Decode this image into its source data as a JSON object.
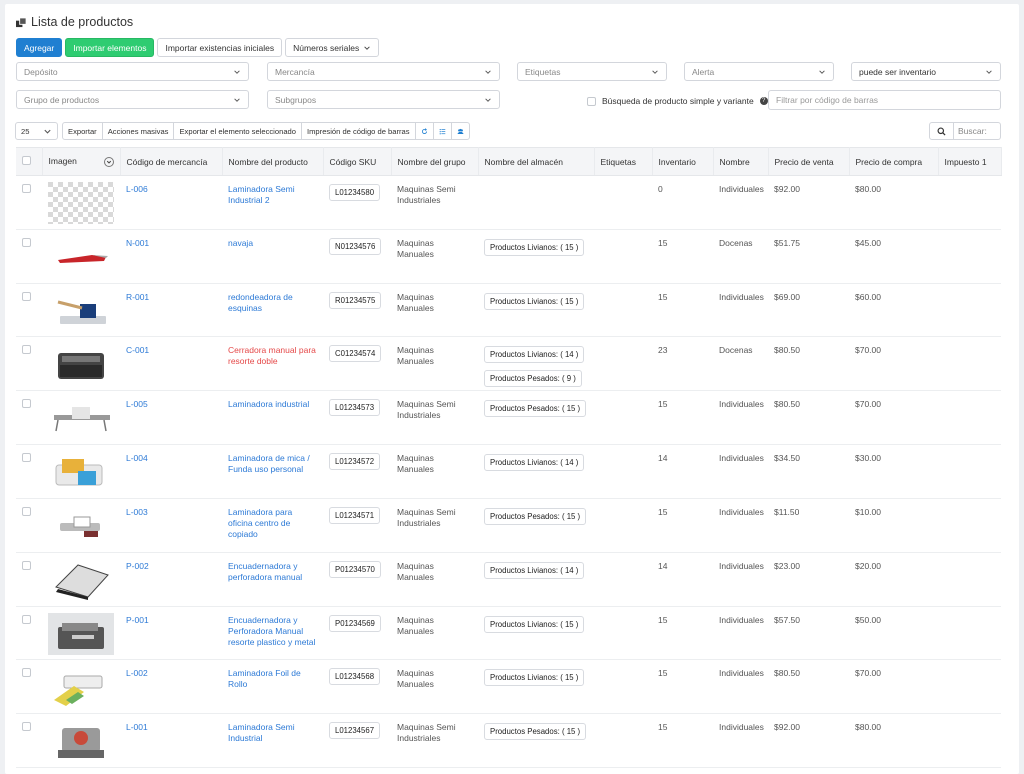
{
  "page": {
    "title": "Lista de productos"
  },
  "toolbar": {
    "add": "Agregar",
    "import_items": "Importar elementos",
    "import_stock": "Importar existencias iniciales",
    "serials": "Números seriales"
  },
  "filters": {
    "deposito": "Depósito",
    "mercancia": "Mercancía",
    "etiquetas": "Etiquetas",
    "alerta": "Alerta",
    "inventario": "puede ser inventario",
    "grupo": "Grupo de productos",
    "subgrupos": "Subgrupos",
    "simple_search": "Búsqueda de producto simple y variante",
    "barcode_placeholder": "Filtrar por código de barras"
  },
  "actions": {
    "page_size": "25",
    "export": "Exportar",
    "bulk": "Acciones masivas",
    "export_selected": "Exportar el elemento seleccionado",
    "print_barcode": "Impresión de código de barras",
    "search_placeholder": "Buscar:"
  },
  "table": {
    "headers": [
      "Imagen",
      "Código de mercancía",
      "Nombre del producto",
      "Código SKU",
      "Nombre del grupo",
      "Nombre del almacén",
      "Etiquetas",
      "Inventario",
      "Nombre",
      "Precio de venta",
      "Precio de compra",
      "Impuesto 1"
    ],
    "rows": [
      {
        "code": "L-006",
        "name": "Laminadora Semi Industrial 2",
        "sku": "L01234580",
        "group": "Maquinas Semi Industriales",
        "warehouses": [],
        "inventory": "0",
        "unit": "Individuales",
        "sale": "$92.00",
        "cost": "$80.00"
      },
      {
        "code": "N-001",
        "name": "navaja",
        "sku": "N01234576",
        "group": "Maquinas Manuales",
        "warehouses": [
          "Productos Livianos: ( 15 )"
        ],
        "inventory": "15",
        "unit": "Docenas",
        "sale": "$51.75",
        "cost": "$45.00"
      },
      {
        "code": "R-001",
        "name": "redondeadora de esquinas",
        "sku": "R01234575",
        "group": "Maquinas Manuales",
        "warehouses": [
          "Productos Livianos: ( 15 )"
        ],
        "inventory": "15",
        "unit": "Individuales",
        "sale": "$69.00",
        "cost": "$60.00"
      },
      {
        "code": "C-001",
        "name": "Cerradora manual para resorte doble",
        "sku": "C01234574",
        "group": "Maquinas Manuales",
        "warehouses": [
          "Productos Livianos: ( 14 )",
          "Productos Pesados: ( 9 )"
        ],
        "inventory": "23",
        "unit": "Docenas",
        "sale": "$80.50",
        "cost": "$70.00"
      },
      {
        "code": "L-005",
        "name": "Laminadora industrial",
        "sku": "L01234573",
        "group": "Maquinas Semi Industriales",
        "warehouses": [
          "Productos Pesados: ( 15 )"
        ],
        "inventory": "15",
        "unit": "Individuales",
        "sale": "$80.50",
        "cost": "$70.00"
      },
      {
        "code": "L-004",
        "name": "Laminadora de mica / Funda uso personal",
        "sku": "L01234572",
        "group": "Maquinas Manuales",
        "warehouses": [
          "Productos Livianos: ( 14 )"
        ],
        "inventory": "14",
        "unit": "Individuales",
        "sale": "$34.50",
        "cost": "$30.00"
      },
      {
        "code": "L-003",
        "name": "Laminadora para oficina centro de copiado",
        "sku": "L01234571",
        "group": "Maquinas Semi Industriales",
        "warehouses": [
          "Productos Pesados: ( 15 )"
        ],
        "inventory": "15",
        "unit": "Individuales",
        "sale": "$11.50",
        "cost": "$10.00"
      },
      {
        "code": "P-002",
        "name": "Encuadernadora y perforadora manual",
        "sku": "P01234570",
        "group": "Maquinas Manuales",
        "warehouses": [
          "Productos Livianos: ( 14 )"
        ],
        "inventory": "14",
        "unit": "Individuales",
        "sale": "$23.00",
        "cost": "$20.00"
      },
      {
        "code": "P-001",
        "name": "Encuadernadora y Perforadora Manual resorte plastico y metal",
        "sku": "P01234569",
        "group": "Maquinas Manuales",
        "warehouses": [
          "Productos Livianos: ( 15 )"
        ],
        "inventory": "15",
        "unit": "Individuales",
        "sale": "$57.50",
        "cost": "$50.00"
      },
      {
        "code": "L-002",
        "name": "Laminadora Foil de Rollo",
        "sku": "L01234568",
        "group": "Maquinas Manuales",
        "warehouses": [
          "Productos Livianos: ( 15 )"
        ],
        "inventory": "15",
        "unit": "Individuales",
        "sale": "$80.50",
        "cost": "$70.00"
      },
      {
        "code": "L-001",
        "name": "Laminadora Semi Industrial",
        "sku": "L01234567",
        "group": "Maquinas Semi Industriales",
        "warehouses": [
          "Productos Pesados: ( 15 )"
        ],
        "inventory": "15",
        "unit": "Individuales",
        "sale": "$92.00",
        "cost": "$80.00"
      }
    ]
  },
  "colors": {
    "primary": "#1f7fd1",
    "success": "#2ecc71",
    "link": "#2d7ad6",
    "alert_text": "#e54848"
  }
}
